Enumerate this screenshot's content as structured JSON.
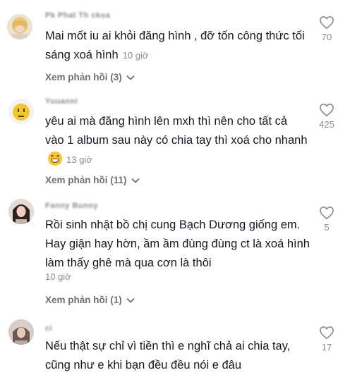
{
  "comments": [
    {
      "username": "Pk Phat Th ckoa",
      "text": "Mai mốt iu ai khỏi đăng hình , đỡ tốn công thức tối sáng xoá hình",
      "time": "10 giờ",
      "replies": "Xem phản hồi (3)",
      "likes": "70",
      "avatar": "blonde-person-avatar"
    },
    {
      "username": "Yuuanni",
      "text": "yêu ai mà đăng hình lên mxh thì nên cho tất cả vào 1 album sau này có chia tay thì xoá cho nhanh",
      "time": "13 giờ",
      "replies": "Xem phản hồi (11)",
      "likes": "425",
      "avatar": "smiley-face-avatar"
    },
    {
      "username": "Fanny Bunny",
      "text": "Rồi sinh nhật bồ chị cung Bạch Dương giống em. Hay giận hay hờn, ầm ầm đùng đùng ct là xoá hình làm thấy ghê mà qua cơn là thôi",
      "time": "10 giờ",
      "replies": "Xem phản hồi (1)",
      "likes": "5",
      "avatar": "girl-portrait-avatar"
    },
    {
      "username": "ci",
      "text": "Nếu thật sự chỉ vì tiền thì e nghĩ chả ai chia tay, cũng như e khi bạn đều đều nói e đâu",
      "likes": "17",
      "avatar": "person-avatar"
    }
  ],
  "colors": {
    "text": "#161823",
    "muted": "#8a8b91",
    "reply": "#6f7077"
  }
}
